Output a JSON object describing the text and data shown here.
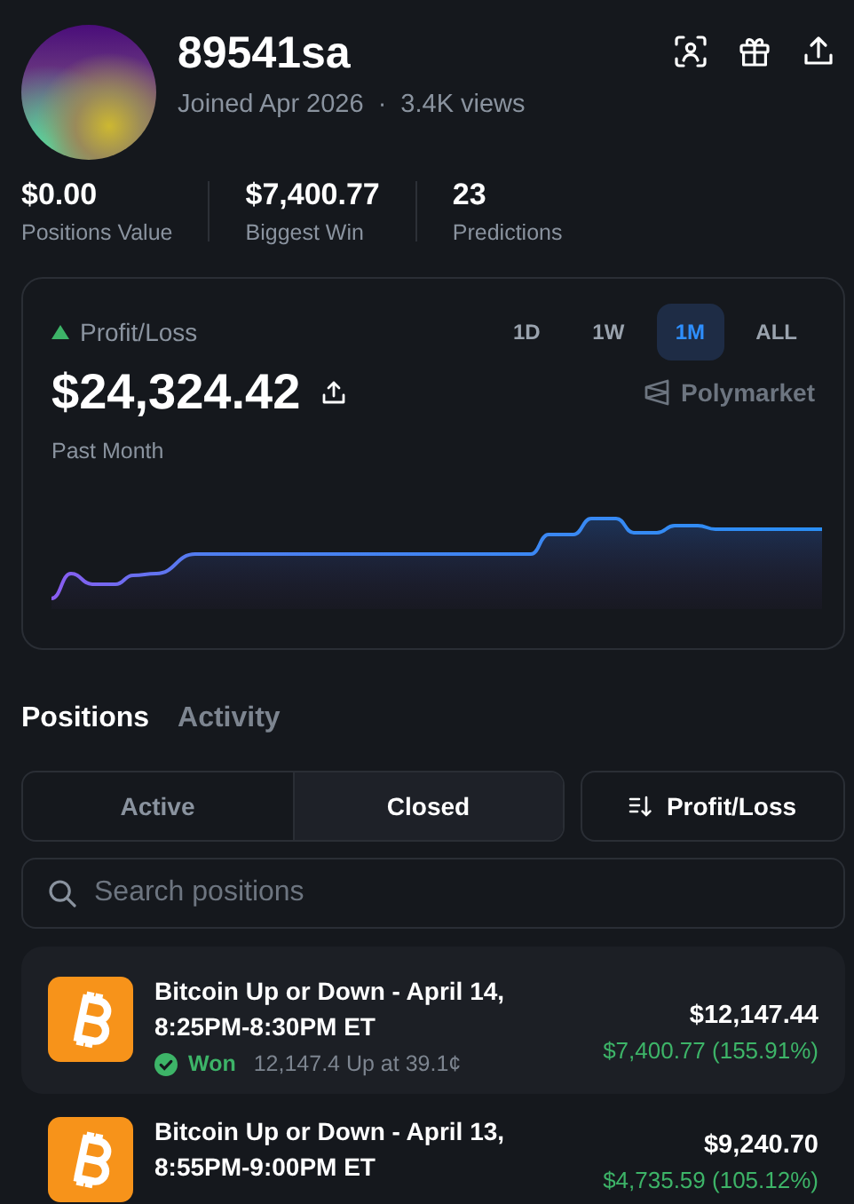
{
  "profile": {
    "username": "89541sa",
    "joined": "Joined Apr 2026",
    "separator": "·",
    "views": "3.4K views"
  },
  "stats": [
    {
      "value": "$0.00",
      "label": "Positions Value"
    },
    {
      "value": "$7,400.77",
      "label": "Biggest Win"
    },
    {
      "value": "23",
      "label": "Predictions"
    }
  ],
  "pnl_card": {
    "label": "Profit/Loss",
    "trend_up": true,
    "ranges": [
      {
        "label": "1D",
        "selected": false
      },
      {
        "label": "1W",
        "selected": false
      },
      {
        "label": "1M",
        "selected": true
      },
      {
        "label": "ALL",
        "selected": false
      }
    ],
    "amount": "$24,324.42",
    "brand": "Polymarket",
    "period": "Past Month"
  },
  "tabs": [
    {
      "label": "Positions",
      "selected": true
    },
    {
      "label": "Activity",
      "selected": false
    }
  ],
  "filter": [
    {
      "label": "Active",
      "selected": false
    },
    {
      "label": "Closed",
      "selected": true
    }
  ],
  "sort_button": "Profit/Loss",
  "search": {
    "placeholder": "Search positions"
  },
  "positions": [
    {
      "title": "Bitcoin Up or Down - April 14, 8:25PM-8:30PM ET",
      "status": "Won",
      "detail": "12,147.4 Up at 39.1¢",
      "value": "$12,147.44",
      "pnl": "$7,400.77 (155.91%)"
    },
    {
      "title": "Bitcoin Up or Down - April 13, 8:55PM-9:00PM ET",
      "value": "$9,240.70",
      "pnl": "$4,735.59 (105.12%)"
    }
  ]
}
